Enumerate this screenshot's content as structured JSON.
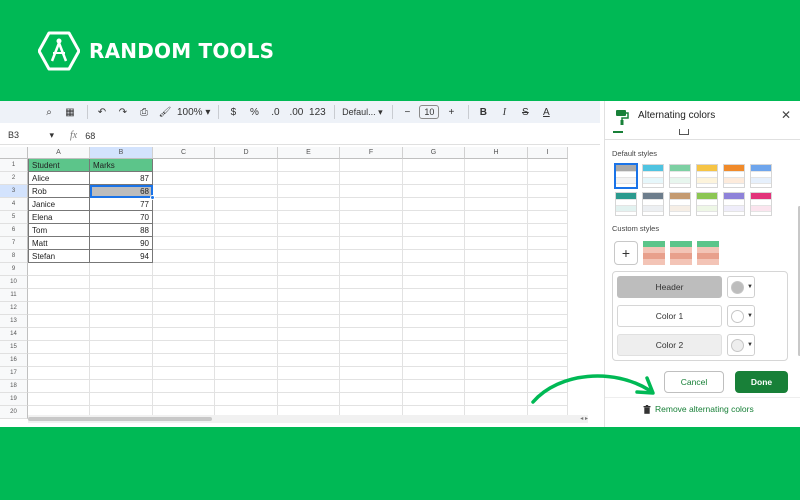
{
  "brand": {
    "name": "RANDOM TOOLS"
  },
  "toolbar": {
    "zoom": "100%",
    "currency": "$",
    "percent": "%",
    "dec_decrease": ".0",
    "dec_increase": ".00",
    "number_format": "123",
    "font": "Defaul...",
    "font_size": "10",
    "bold": "B",
    "italic": "I",
    "strike": "S",
    "underline": "A"
  },
  "formula_bar": {
    "cell_ref": "B3",
    "fx": "fx",
    "value": "68"
  },
  "sheet": {
    "columns": [
      "A",
      "B",
      "C",
      "D",
      "E",
      "F",
      "G",
      "H",
      "I"
    ],
    "rows": [
      "1",
      "2",
      "3",
      "4",
      "5",
      "6",
      "7",
      "8",
      "9",
      "10",
      "11",
      "12",
      "13",
      "14",
      "15",
      "16",
      "17",
      "18",
      "19",
      "20"
    ],
    "table": {
      "headers": [
        "Student",
        "Marks"
      ],
      "records": [
        {
          "name": "Alice",
          "mark": "87"
        },
        {
          "name": "Rob",
          "mark": "68"
        },
        {
          "name": "Janice",
          "mark": "77"
        },
        {
          "name": "Elena",
          "mark": "70"
        },
        {
          "name": "Tom",
          "mark": "88"
        },
        {
          "name": "Matt",
          "mark": "90"
        },
        {
          "name": "Stefan",
          "mark": "94"
        }
      ]
    }
  },
  "panel": {
    "title": "Alternating colors",
    "close": "✕",
    "default_styles_label": "Default styles",
    "custom_styles_label": "Custom styles",
    "add_custom": "+",
    "default_styles": [
      {
        "head": "#a9a9a9",
        "row": "#f3f3f3"
      },
      {
        "head": "#4fc3e0",
        "row": "#e6f7fb"
      },
      {
        "head": "#7dd0a3",
        "row": "#e7f6ee"
      },
      {
        "head": "#f6c445",
        "row": "#fdf4dc"
      },
      {
        "head": "#f08a2a",
        "row": "#fdebdc"
      },
      {
        "head": "#6ea5ec",
        "row": "#e6f0fc"
      },
      {
        "head": "#2b9a8e",
        "row": "#e2f2f0"
      },
      {
        "head": "#6d7d8c",
        "row": "#eceff2"
      },
      {
        "head": "#c49a70",
        "row": "#f6eee5"
      },
      {
        "head": "#8cc653",
        "row": "#eef7e6"
      },
      {
        "head": "#8e82d9",
        "row": "#efedfa"
      },
      {
        "head": "#e2337a",
        "row": "#fbe4ee"
      }
    ],
    "custom_style": {
      "head": "#5cc58a",
      "row": "#e8a08c"
    },
    "header_label": "Header",
    "color1_label": "Color 1",
    "color2_label": "Color 2",
    "header_color": "#bdbdbd",
    "color1_color": "#ffffff",
    "color2_color": "#eeeeee",
    "cancel": "Cancel",
    "done": "Done",
    "remove": "Remove alternating colors"
  }
}
